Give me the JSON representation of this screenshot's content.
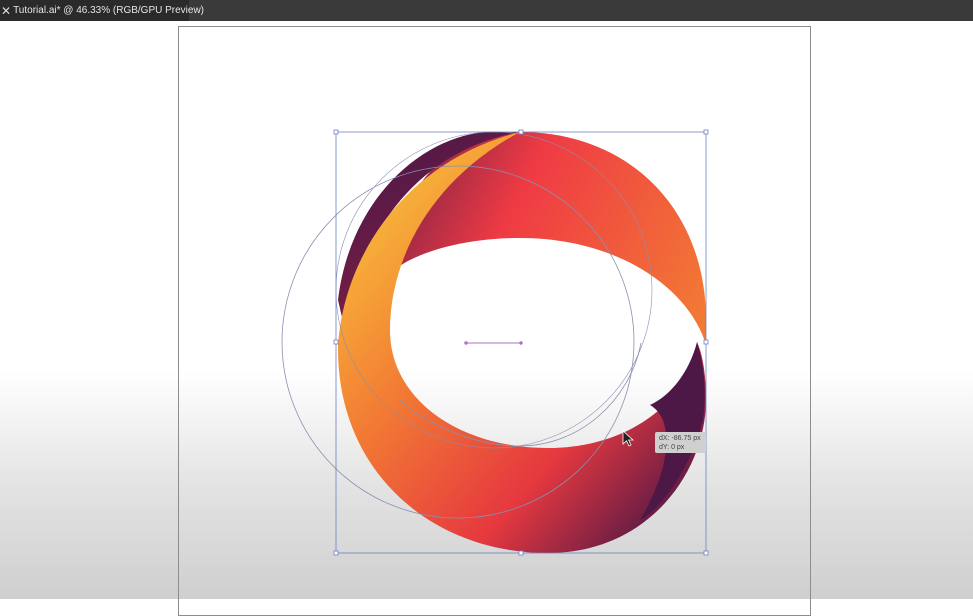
{
  "window": {
    "tab_title": "Tutorial.ai* @ 46.33% (RGB/GPU Preview)",
    "close_glyph": "✕"
  },
  "tooltip": {
    "dx": "dX: -86.75 px",
    "dy": "dY: 0 px"
  },
  "colors": {
    "tabbar": "#3a3a3a",
    "selection": "#6f7fc0",
    "center_mark": "#b070c0",
    "grad_red": "#ef3b44",
    "grad_orange": "#f27a34",
    "grad_yellow": "#f8bb3a",
    "grad_purple": "#4d1746",
    "grad_crimson": "#b42843"
  },
  "icons": {
    "close": "close-icon",
    "cursor": "arrow-cursor-icon"
  }
}
